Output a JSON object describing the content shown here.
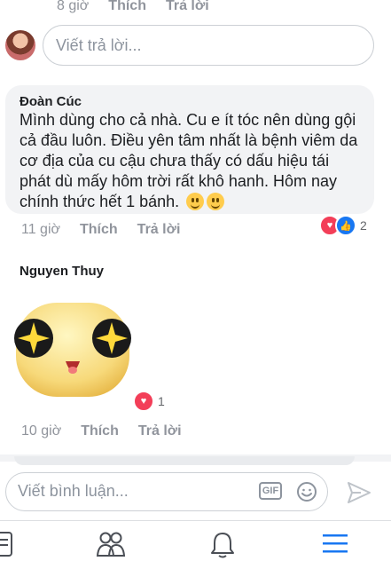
{
  "top_comment": {
    "time": "8 giờ",
    "like": "Thích",
    "reply": "Trả lời"
  },
  "reply_box": {
    "placeholder": "Viết trả lời..."
  },
  "comment1": {
    "author": "Đoàn Cúc",
    "text": "Mình dùng cho cả nhà. Cu e ít tóc nên dùng gội cả đầu luôn. Điều yên tâm nhất là  bệnh viêm da cơ địa của cu cậu chưa thấy có dấu hiệu tái phát dù mấy hôm trời rất khô hanh. Hôm nay chính thức hết 1 bánh.",
    "time": "11 giờ",
    "like": "Thích",
    "reply": "Trả lời",
    "reaction_count": "2",
    "reactions": [
      "heart-icon",
      "like-icon"
    ]
  },
  "comment2": {
    "author": "Nguyen Thuy",
    "sticker": "star-eyes-emoji-sticker",
    "time": "10 giờ",
    "like": "Thích",
    "reply": "Trả lời",
    "reaction_count": "1",
    "reactions": [
      "heart-icon"
    ]
  },
  "composer": {
    "placeholder": "Viết bình luận...",
    "gif_label": "GIF"
  },
  "tabbar": {
    "icons": [
      "news-feed-icon",
      "friends-icon",
      "notifications-icon",
      "menu-icon"
    ]
  },
  "colors": {
    "like_blue": "#1877f2",
    "heart_red": "#f33e58",
    "meta_gray": "#90949c",
    "bubble_bg": "#f2f3f5"
  }
}
